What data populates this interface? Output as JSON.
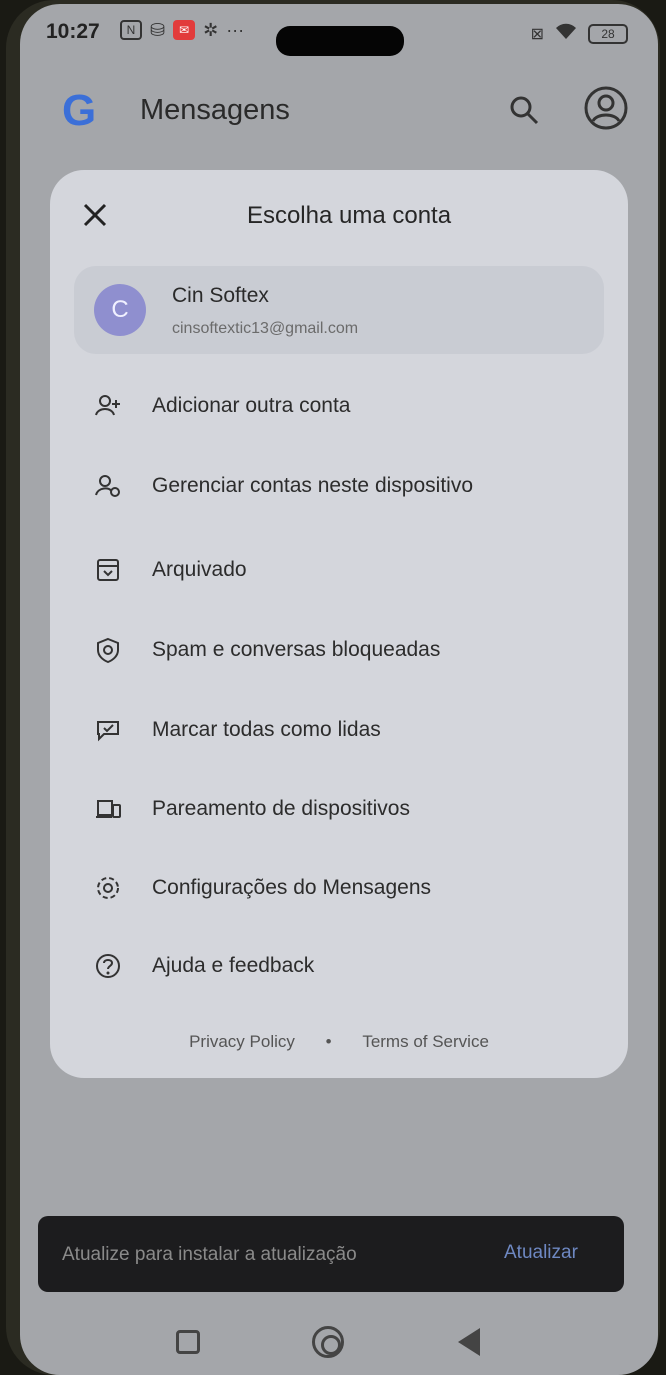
{
  "status_bar": {
    "time": "10:27",
    "battery": "28"
  },
  "app_bar": {
    "logo": "G",
    "title": "Mensagens"
  },
  "dialog": {
    "title": "Escolha uma conta",
    "account": {
      "initial": "C",
      "name": "Cin Softex",
      "email": "cinsoftextic13@gmail.com"
    },
    "menu": [
      {
        "label": "Adicionar outra conta",
        "icon": "add-person-icon"
      },
      {
        "label": "Gerenciar contas neste dispositivo",
        "icon": "manage-accounts-icon"
      },
      {
        "label": "Arquivado",
        "icon": "archive-icon"
      },
      {
        "label": "Spam e conversas bloqueadas",
        "icon": "shield-icon"
      },
      {
        "label": "Marcar todas como lidas",
        "icon": "mark-read-icon"
      },
      {
        "label": "Pareamento de dispositivos",
        "icon": "devices-icon"
      },
      {
        "label": "Configurações do Mensagens",
        "icon": "gear-icon"
      },
      {
        "label": "Ajuda e feedback",
        "icon": "help-icon"
      }
    ],
    "footer": {
      "privacy": "Privacy Policy",
      "separator": "•",
      "terms": "Terms of Service"
    }
  },
  "snackbar": {
    "message": "Atualize para instalar a atualização",
    "action": "Atualizar"
  },
  "colors": {
    "accent": "#6e88c2",
    "avatar": "#8f8fcf",
    "dialog_bg": "#d4d6dc",
    "snackbar_bg": "#1c1c1e"
  }
}
